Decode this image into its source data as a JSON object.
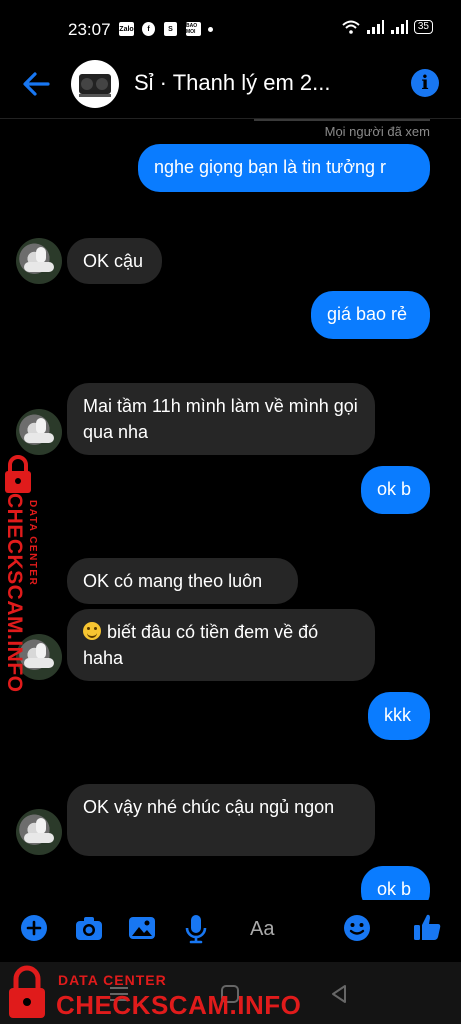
{
  "status_bar": {
    "time": "23:07",
    "notif_icons": [
      "Zalo",
      "f",
      "S",
      "BAO MOI"
    ],
    "battery": "35"
  },
  "header": {
    "title": "Sỉ · Thanh lý em 2...",
    "info_glyph": "i"
  },
  "seen_label": "Mọi người đã xem",
  "messages": [
    {
      "side": "out",
      "text": "nghe giọng bạn là tin tưởng r"
    },
    {
      "side": "in",
      "text": "OK cậu"
    },
    {
      "side": "out",
      "text": "giá bao rẻ"
    },
    {
      "side": "in",
      "text": "Mai tầm 11h mình làm về mình gọi qua nha"
    },
    {
      "side": "out",
      "text": "ok b"
    },
    {
      "side": "in",
      "text": "OK có mang theo luôn"
    },
    {
      "side": "in",
      "text": "biết đâu có tiền đem về đó haha"
    },
    {
      "side": "out",
      "text": "kkk"
    },
    {
      "side": "in",
      "text": "OK vậy nhé chúc cậu ngủ ngon"
    },
    {
      "side": "out",
      "text": "ok b"
    }
  ],
  "composer": {
    "placeholder": "Aa"
  },
  "watermark": {
    "title": "DATA CENTER",
    "brand": "CHECKSCAM.INFO"
  },
  "colors": {
    "accent": "#0a7cff",
    "incoming_bubble": "#262626",
    "watermark": "#e01b1b"
  }
}
